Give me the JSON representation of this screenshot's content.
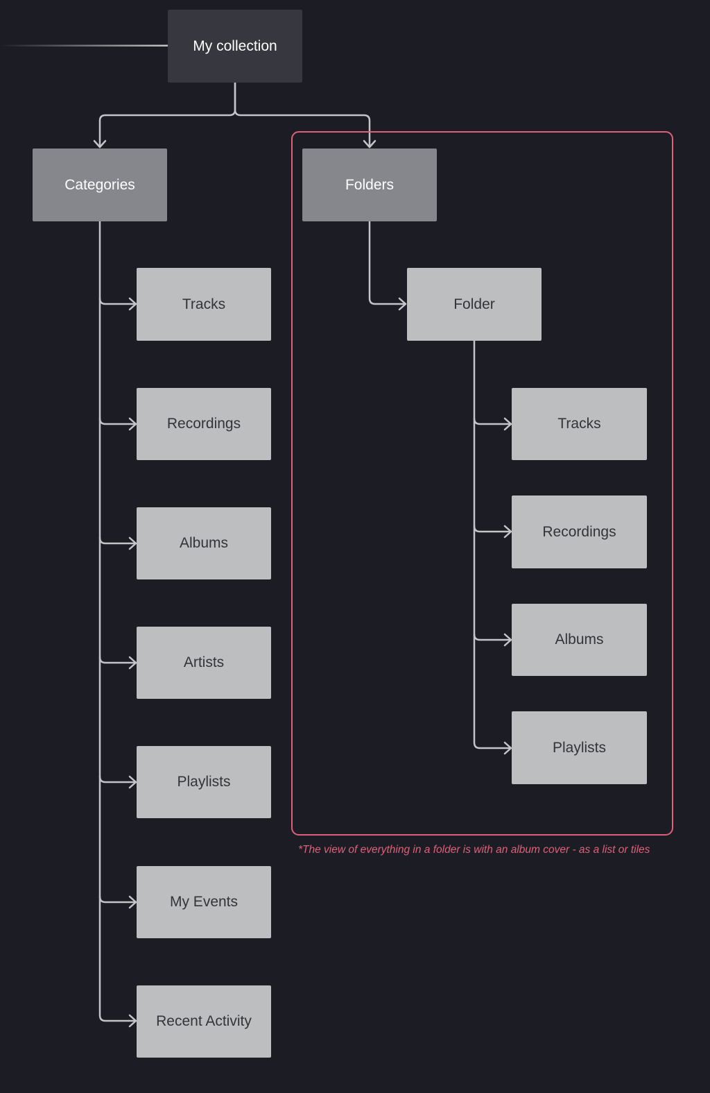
{
  "diagram": {
    "root": {
      "label": "My collection"
    },
    "categories": {
      "label": "Categories",
      "children": [
        "Tracks",
        "Recordings",
        "Albums",
        "Artists",
        "Playlists",
        "My Events",
        "Recent Activity"
      ]
    },
    "folders": {
      "label": "Folders",
      "folder": {
        "label": "Folder",
        "children": [
          "Tracks",
          "Recordings",
          "Albums",
          "Playlists"
        ]
      }
    },
    "note": "*The view of everything in a folder is with an album cover - as a list or tiles"
  },
  "colors": {
    "background": "#1c1d24",
    "root_node": "#373740",
    "mid_node": "#86878c",
    "leaf_node": "#bdbec0",
    "connector": "#c4c5c8",
    "highlight": "#e0607a"
  }
}
